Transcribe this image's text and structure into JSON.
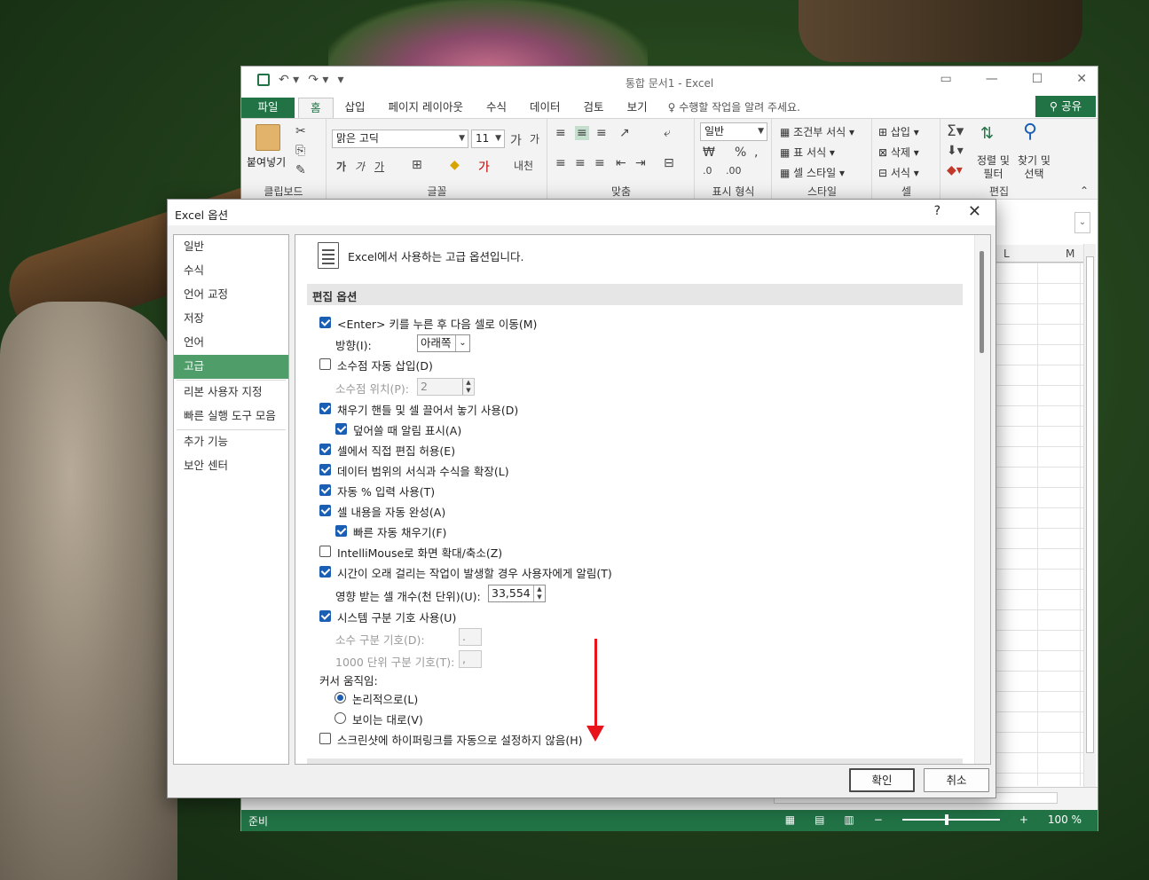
{
  "excel": {
    "title": "통합 문서1 - Excel",
    "tabs": [
      "파일",
      "홈",
      "삽입",
      "페이지 레이아웃",
      "수식",
      "데이터",
      "검토",
      "보기"
    ],
    "tell_me": "수행할 작업을 알려 주세요.",
    "share": "공유",
    "ribbon": {
      "clipboard_label": "클립보드",
      "paste_label": "붙여넣기",
      "font_label": "글꼴",
      "font_name": "맑은 고딕",
      "font_size": "11",
      "align_label": "맞춤",
      "number_label": "표시 형식",
      "number_format": "일반",
      "styles_label": "스타일",
      "cond_format": "조건부 서식",
      "table_format": "표 서식",
      "cell_style": "셀 스타일",
      "cells_label": "셀",
      "insert": "삽입",
      "delete": "삭제",
      "format": "서식",
      "edit_label": "편집",
      "sort_filter": "정렬 및\n필터",
      "find_select": "찾기 및\n선택"
    },
    "columns": [
      "L",
      "M"
    ],
    "status": "준비",
    "zoom": "100 %"
  },
  "dialog": {
    "title": "Excel 옵션",
    "help": "?",
    "nav": [
      "일반",
      "수식",
      "언어 교정",
      "저장",
      "언어",
      "고급",
      "리본 사용자 지정",
      "빠른 실행 도구 모음",
      "추가 기능",
      "보안 센터"
    ],
    "selected_nav": "고급",
    "header": "Excel에서 사용하는 고급 옵션입니다.",
    "section": "편집 옵션",
    "options": {
      "enter_move": "<Enter> 키를 누른 후 다음 셀로 이동(M)",
      "direction_label": "방향(I):",
      "direction_value": "아래쪽",
      "auto_decimal": "소수점 자동 삽입(D)",
      "decimal_places_label": "소수점 위치(P):",
      "decimal_places_value": "2",
      "fill_handle": "채우기 핸들 및 셀 끌어서 놓기 사용(D)",
      "alert_overwrite": "덮어쓸 때 알림 표시(A)",
      "edit_in_cell": "셀에서 직접 편집 허용(E)",
      "extend_formats": "데이터 범위의 서식과 수식을 확장(L)",
      "auto_percent": "자동 % 입력 사용(T)",
      "autocomplete": "셀 내용을 자동 완성(A)",
      "flash_fill": "빠른 자동 채우기(F)",
      "intellimouse": "IntelliMouse로 화면 확대/축소(Z)",
      "alert_slow": "시간이 오래 걸리는 작업이 발생할 경우 사용자에게 알림(T)",
      "cells_affected_label": "영향 받는 셀 개수(천 단위)(U):",
      "cells_affected_value": "33,554",
      "system_separators": "시스템 구분 기호 사용(U)",
      "decimal_sep_label": "소수 구분 기호(D):",
      "decimal_sep_value": ".",
      "thousands_sep_label": "1000 단위 구분 기호(T):",
      "thousands_sep_value": ",",
      "cursor_label": "커서 움직임:",
      "cursor_logical": "논리적으로(L)",
      "cursor_visual": "보이는 대로(V)",
      "no_hyperlink": "스크린샷에 하이퍼링크를 자동으로 설정하지 않음(H)"
    },
    "ok": "확인",
    "cancel": "취소"
  },
  "colors": {
    "excel_green": "#217346",
    "nav_selected": "#4f9d69",
    "annotation_arrow": "#e8141c",
    "checkbox": "#1a5fb4"
  }
}
